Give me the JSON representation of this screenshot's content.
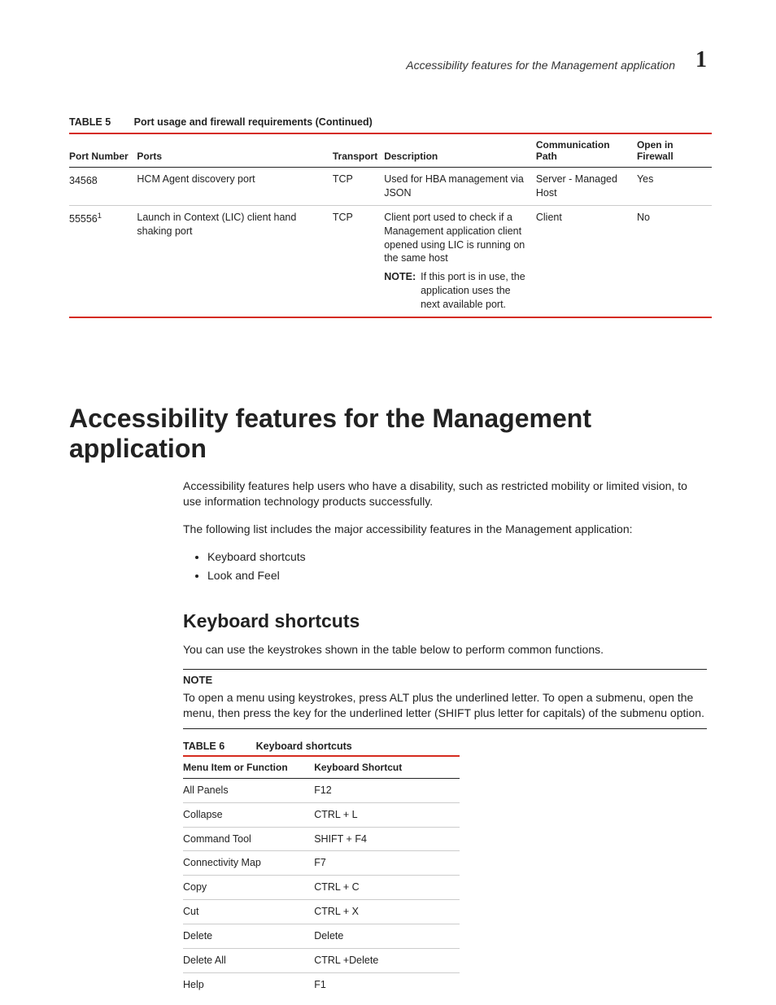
{
  "header": {
    "running_title": "Accessibility features for the Management application",
    "chapter_number": "1"
  },
  "table5": {
    "caption_label": "TABLE 5",
    "caption_title": "Port usage and firewall requirements (Continued)",
    "headers": {
      "port_number": "Port Number",
      "ports": "Ports",
      "transport": "Transport",
      "description": "Description",
      "comm_path": "Communication Path",
      "open_fw": "Open in Firewall"
    },
    "rows": [
      {
        "port_number": "34568",
        "port_sup": "",
        "ports": "HCM Agent discovery port",
        "transport": "TCP",
        "description": "Used for HBA management via JSON",
        "note_label": "",
        "note_body": "",
        "comm_path": "Server - Managed Host",
        "open_fw": "Yes"
      },
      {
        "port_number": "55556",
        "port_sup": "1",
        "ports": "Launch in Context (LIC) client hand shaking port",
        "transport": "TCP",
        "description": "Client port used to check if a Management application client opened using LIC is running on the same host",
        "note_label": "NOTE:",
        "note_body": "If this port is in use, the application uses the next available port.",
        "comm_path": "Client",
        "open_fw": "No"
      }
    ]
  },
  "section": {
    "title": "Accessibility features for the Management application",
    "intro1": "Accessibility features help users who have a disability, such as restricted mobility or limited vision, to use information technology products successfully.",
    "intro2": "The following list includes the major accessibility features in the Management application:",
    "bullets": [
      "Keyboard shortcuts",
      "Look and Feel"
    ]
  },
  "keyboard": {
    "heading": "Keyboard shortcuts",
    "lead": "You can use the keystrokes shown in the table below to perform common functions.",
    "note_label": "NOTE",
    "note_body": "To open a menu using keystrokes, press ALT plus the underlined letter. To open a submenu, open the menu, then press the key for the underlined letter (SHIFT plus letter for capitals) of the submenu option.",
    "table_caption_label": "TABLE 6",
    "table_caption_title": "Keyboard shortcuts",
    "headers": {
      "func": "Menu Item or Function",
      "shortcut": "Keyboard Shortcut"
    },
    "rows": [
      {
        "func": "All Panels",
        "shortcut": "F12"
      },
      {
        "func": "Collapse",
        "shortcut": "CTRL + L"
      },
      {
        "func": "Command Tool",
        "shortcut": "SHIFT + F4"
      },
      {
        "func": "Connectivity Map",
        "shortcut": "F7"
      },
      {
        "func": "Copy",
        "shortcut": "CTRL + C"
      },
      {
        "func": "Cut",
        "shortcut": "CTRL + X"
      },
      {
        "func": "Delete",
        "shortcut": "Delete"
      },
      {
        "func": "Delete All",
        "shortcut": "CTRL +Delete"
      },
      {
        "func": "Help",
        "shortcut": "F1"
      }
    ]
  }
}
